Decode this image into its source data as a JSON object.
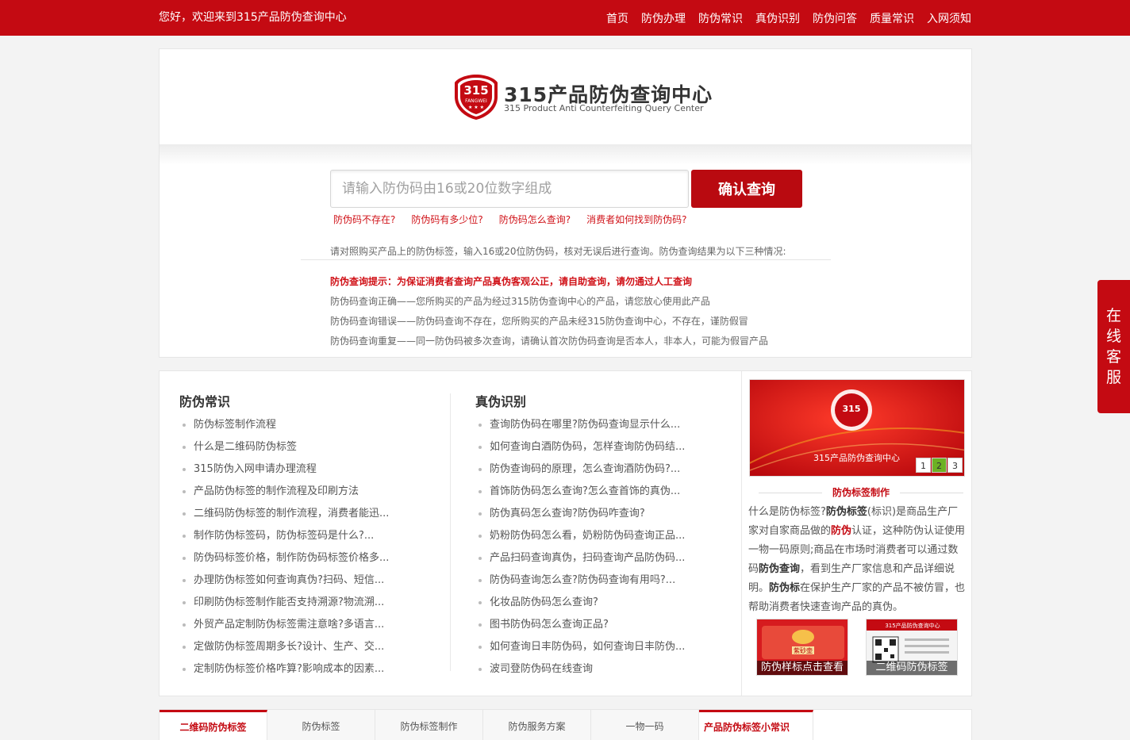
{
  "topbar": {
    "welcome": "您好，欢迎来到315产品防伪查询中心",
    "nav": [
      "首页",
      "防伪办理",
      "防伪常识",
      "真伪识别",
      "防伪问答",
      "质量常识",
      "入网须知"
    ]
  },
  "logo": {
    "badge_text": "315",
    "badge_sub": "FANGWEI",
    "title": "315产品防伪查询中心",
    "subtitle": "315 Product Anti Counterfeiting Query Center"
  },
  "search": {
    "placeholder": "请输入防伪码由16或20位数字组成",
    "button": "确认查询",
    "quick_links": [
      "防伪码不存在?",
      "防伪码有多少位?",
      "防伪码怎么查询?",
      "消费者如何找到防伪码?"
    ]
  },
  "intro": "请对照购买产品上的防伪标签，输入16或20位防伪码，核对无误后进行查询。防伪查询结果为以下三种情况:",
  "tips": {
    "warning": "防伪查询提示：为保证消费者查询产品真伪客观公正，请自助查询，请勿通过人工查询",
    "items": [
      "防伪码查询正确——您所购买的产品为经过315防伪查询中心的产品，请您放心使用此产品",
      "防伪码查询错误——防伪码查询不存在，您所购买的产品未经315防伪查询中心，不存在，谨防假冒",
      "防伪码查询重复——同一防伪码被多次查询，请确认首次防伪码查询是否本人，非本人，可能为假冒产品"
    ]
  },
  "knowledge": {
    "title": "防伪常识",
    "items": [
      "防伪标签制作流程",
      "什么是二维码防伪标签",
      "315防伪入网申请办理流程",
      "产品防伪标签的制作流程及印刷方法",
      "二维码防伪标签的制作流程，消费者能迅...",
      "制作防伪标签码，防伪标签码是什么?...",
      "防伪码标签价格，制作防伪码标签价格多...",
      "办理防伪标签如何查询真伪?扫码、短信...",
      "印刷防伪标签制作能否支持溯源?物流溯...",
      "外贸产品定制防伪标签需注意啥?多语言...",
      "定做防伪标签周期多长?设计、生产、交...",
      "定制防伪标签价格咋算?影响成本的因素..."
    ]
  },
  "identify": {
    "title": "真伪识别",
    "items": [
      "查询防伪码在哪里?防伪码查询显示什么...",
      "如何查询白酒防伪码，怎样查询防伪码结...",
      "防伪查询码的原理，怎么查询酒防伪码?...",
      "首饰防伪码怎么查询?怎么查首饰的真伪...",
      "防伪真码怎么查询?防伪码咋查询?",
      "奶粉防伪码怎么看，奶粉防伪码查询正品...",
      "产品扫码查询真伪，扫码查询产品防伪码...",
      "防伪码查询怎么查?防伪码查询有用吗?...",
      "化妆品防伪码怎么查询?",
      "图书防伪码怎么查询正品?",
      "如何查询日丰防伪码，如何查询日丰防伪...",
      "波司登防伪码在线查询"
    ]
  },
  "sidebar": {
    "banner_text": "315产品防伪查询中心",
    "slides": [
      "1",
      "2",
      "3"
    ],
    "active_slide": "2",
    "title": "防伪标签制作",
    "text_parts": [
      "什么是防伪标签?",
      "防伪标签",
      "(标识)是商品生产厂家对自家商品做的",
      "防伪",
      "认证，这种防伪认证使用一物一码原则;商品在市场时消费者可以通过数码",
      "防伪查询",
      "，看到生产厂家信息和产品详细说明。",
      "防伪标",
      "在保护生产厂家的产品不被仿冒，也帮助消费者快速查询产品的真伪。"
    ],
    "thumb1_caption": "防伪样标点击查看",
    "thumb2_caption": "二维码防伪标签",
    "thumb1_inner": "紫砂壶",
    "thumb2_inner": "315产品防伪查询中心"
  },
  "tabs": {
    "items": [
      "二维码防伪标签",
      "防伪标签",
      "防伪标签制作",
      "防伪服务方案",
      "一物一码"
    ],
    "active": "二维码防伪标签",
    "side_title": "产品防伪标签小常识"
  },
  "service": {
    "label_chars": [
      "在",
      "线",
      "客",
      "服"
    ]
  },
  "colors": {
    "brand_red": "#c40a12",
    "link_red": "#d01218",
    "slide_active": "#6db124"
  }
}
